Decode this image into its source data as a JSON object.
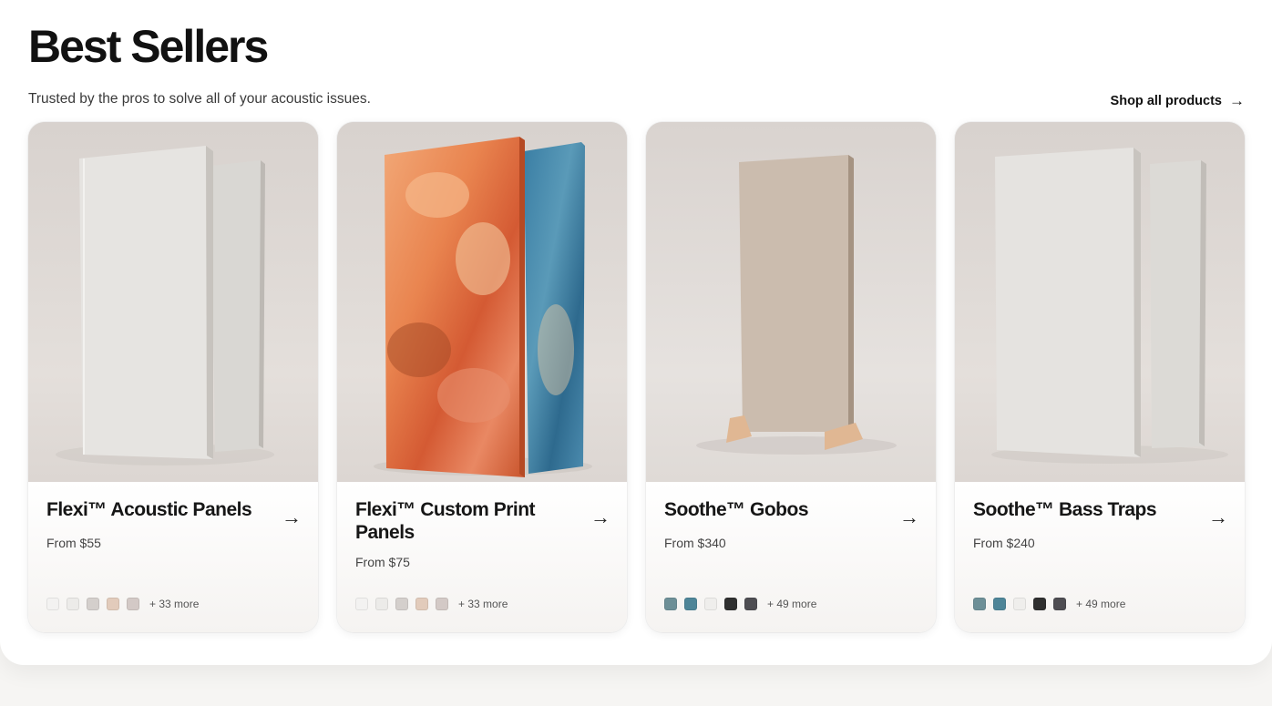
{
  "header": {
    "title": "Best Sellers",
    "subtitle": "Trusted by the pros to solve all of your acoustic issues.",
    "shop_all": "Shop all products",
    "shop_all_arrow": "→"
  },
  "products": [
    {
      "name": "Flexi™ Acoustic Panels",
      "price": "From $55",
      "swatches": [
        "#f3f2f1",
        "#ecebe9",
        "#d4cfcc",
        "#e2cbbb",
        "#d3c9c6"
      ],
      "more": "+ 33 more"
    },
    {
      "name": "Flexi™ Custom Print Panels",
      "price": "From $75",
      "swatches": [
        "#f3f2f1",
        "#ecebe9",
        "#d4cfcc",
        "#e2cbbb",
        "#d3c9c6"
      ],
      "more": "+ 33 more"
    },
    {
      "name": "Soothe™ Gobos",
      "price": "From $340",
      "swatches": [
        "#6d8f97",
        "#4e8598",
        "#efeeec",
        "#2f2f2f",
        "#4e4d52"
      ],
      "more": "+ 49 more"
    },
    {
      "name": "Soothe™ Bass Traps",
      "price": "From $240",
      "swatches": [
        "#6d8f97",
        "#4e8598",
        "#efeeec",
        "#2f2f2f",
        "#4e4d52"
      ],
      "more": "+ 49 more"
    }
  ],
  "card_arrow": "→"
}
